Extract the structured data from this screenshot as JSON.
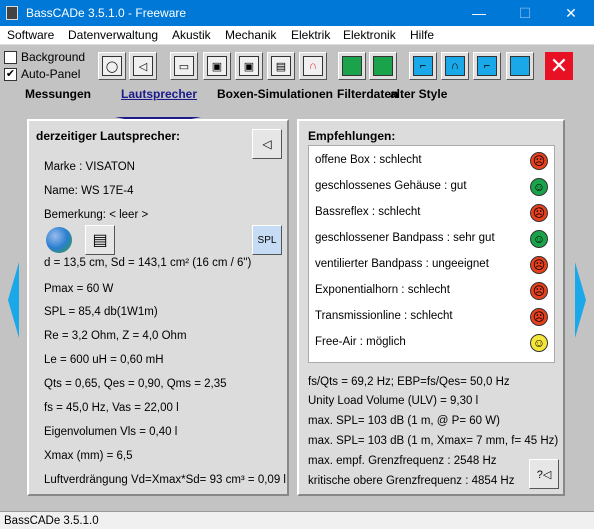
{
  "window": {
    "title": "BassCADe 3.5.1.0 - Freeware",
    "minimize": "—",
    "maximize": "☐",
    "close": "✕"
  },
  "menu": [
    "Software",
    "Datenverwaltung",
    "Akustik",
    "Mechanik",
    "Elektrik",
    "Elektronik",
    "Hilfe"
  ],
  "options": {
    "background": {
      "label": "Background",
      "checked": false
    },
    "auto_panel": {
      "label": "Auto-Panel",
      "checked": true
    }
  },
  "categories": [
    "Messungen",
    "Lautsprecher",
    "Boxen-Simulationen",
    "Filterdaten",
    "alter Style"
  ],
  "active_category": "Lautsprecher",
  "toolbar_close": "✕",
  "left_panel": {
    "title": "derzeitiger Lautsprecher:",
    "spl_button": "SPL",
    "rows": [
      "Marke : VISATON",
      "Name: WS 17E-4",
      "Bemerkung: < leer >",
      "d = 13,5 cm, Sd = 143,1 cm² (16 cm / 6\")",
      "Pmax = 60 W",
      "SPL = 85,4 db(1W1m)",
      "Re = 3,2 Ohm, Z = 4,0 Ohm",
      "Le = 600 uH = 0,60 mH",
      "Qts = 0,65, Qes = 0,90, Qms = 2,35",
      "fs = 45,0 Hz, Vas = 22,00 l",
      "Eigenvolumen Vls = 0,40 l",
      "Xmax (mm) = 6,5",
      "Luftverdrängung Vd=Xmax*Sd= 93 cm³ = 0,09 l"
    ]
  },
  "right_panel": {
    "title": "Empfehlungen:",
    "recommendations": [
      {
        "text": "offene Box : schlecht",
        "rating": "bad"
      },
      {
        "text": "geschlossenes Gehäuse : gut",
        "rating": "good"
      },
      {
        "text": "Bassreflex : schlecht",
        "rating": "bad"
      },
      {
        "text": "geschlossener Bandpass : sehr gut",
        "rating": "good"
      },
      {
        "text": "ventilierter Bandpass : ungeeignet",
        "rating": "bad"
      },
      {
        "text": "Exponentialhorn : schlecht",
        "rating": "bad"
      },
      {
        "text": "Transmissionline : schlecht",
        "rating": "bad"
      },
      {
        "text": "Free-Air : möglich",
        "rating": "neutral"
      }
    ],
    "info": [
      "fs/Qts = 69,2 Hz; EBP=fs/Qes= 50,0 Hz",
      "Unity Load Volume (ULV) = 9,30 l",
      "max. SPL= 103 dB (1 m, @ P= 60 W)",
      "max. SPL= 103 dB (1 m, Xmax= 7 mm, f= 45 Hz)",
      "max. empf. Grenzfrequenz : 2548 Hz",
      "kritische obere Grenzfrequenz : 4854 Hz"
    ]
  },
  "colors": {
    "good": "#1aa34a",
    "bad": "#e8401c",
    "neutral": "#f5e63a",
    "accent": "#1ba8e8",
    "titlebar": "#0078d7"
  },
  "status": "BassCADe 3.5.1.0"
}
